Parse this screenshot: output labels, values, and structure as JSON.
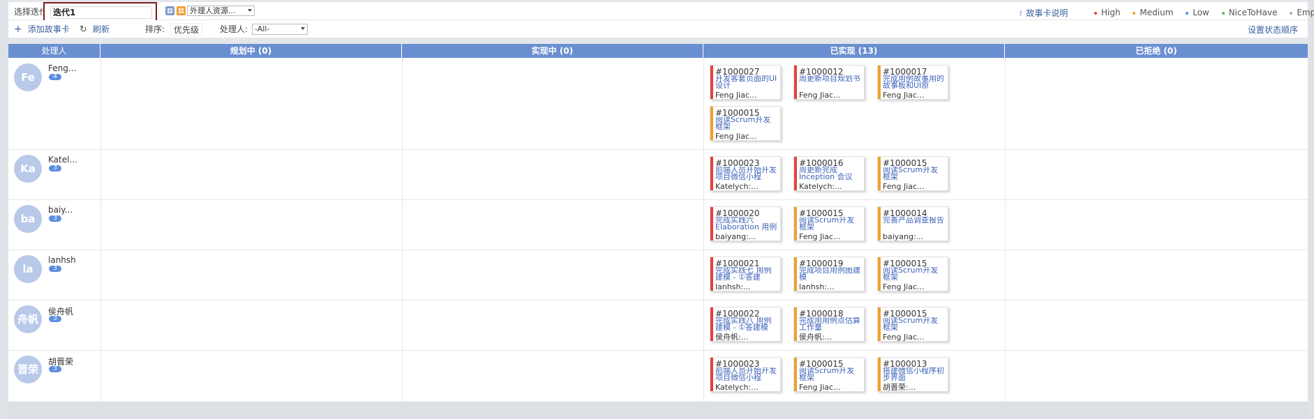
{
  "toolbar": {
    "iteration_label": "选择迭代:",
    "iteration_value": "迭代1",
    "resource_select": "外理人资源...",
    "story_card_help": "故事卡说明",
    "add_story_card": "添加故事卡",
    "refresh": "刷新",
    "sort_label": "排序:",
    "sort_value": "优先级",
    "assignee_label": "处理人:",
    "assignee_value": "-All-",
    "set_status_order": "设置状态顺序"
  },
  "legend": [
    {
      "label": "High",
      "color": "#e84040"
    },
    {
      "label": "Medium",
      "color": "#f0a030"
    },
    {
      "label": "Low",
      "color": "#4a90e2"
    },
    {
      "label": "NiceToHave",
      "color": "#5cb85c"
    },
    {
      "label": "Empty",
      "color": "#aaaaaa"
    }
  ],
  "columns": {
    "assignee": "处理人",
    "planning": "规划中 (0)",
    "in_progress": "实现中 (0)",
    "done": "已实现 (13)",
    "rejected": "已拒绝 (0)"
  },
  "rows": [
    {
      "avatar": "Fe",
      "name": "Feng...",
      "count": "4",
      "cards": [
        {
          "id": "#1000027",
          "title": "开发客套页面的UI设计",
          "owner": "Feng Jiac...",
          "priority": "High"
        },
        {
          "id": "#1000012",
          "title": "周更新项目规划书",
          "owner": "Feng Jiac...",
          "priority": "High"
        },
        {
          "id": "#1000017",
          "title": "完成用例故事用的故事板和UI原",
          "owner": "Feng Jiac...",
          "priority": "Medium"
        },
        {
          "id": "#1000015",
          "title": "阅读Scrum开发框架",
          "owner": "Feng Jiac...",
          "priority": "Medium"
        }
      ]
    },
    {
      "avatar": "Ka",
      "name": "Katel...",
      "count": "3",
      "cards": [
        {
          "id": "#1000023",
          "title": "前端人员开始开发项目微信小程",
          "owner": "Katelych:...",
          "priority": "High"
        },
        {
          "id": "#1000016",
          "title": "周更新完成Inception 会议",
          "owner": "Katelych:...",
          "priority": "High"
        },
        {
          "id": "#1000015",
          "title": "阅读Scrum开发框架",
          "owner": "Feng Jiac...",
          "priority": "Medium"
        }
      ]
    },
    {
      "avatar": "ba",
      "name": "baiy...",
      "count": "3",
      "cards": [
        {
          "id": "#1000020",
          "title": "完成实践六 Elaboration 用例",
          "owner": "baiyang:...",
          "priority": "High"
        },
        {
          "id": "#1000015",
          "title": "阅读Scrum开发框架",
          "owner": "Feng Jiac...",
          "priority": "Medium"
        },
        {
          "id": "#1000014",
          "title": "完善产品调查报告",
          "owner": "baiyang:...",
          "priority": "Medium"
        }
      ]
    },
    {
      "avatar": "la",
      "name": "lanhsh",
      "count": "3",
      "cards": [
        {
          "id": "#1000021",
          "title": "完成实践七 用例建模 - ①答建",
          "owner": "lanhsh:...",
          "priority": "High"
        },
        {
          "id": "#1000019",
          "title": "完成项目用例图建模",
          "owner": "lanhsh:...",
          "priority": "Medium"
        },
        {
          "id": "#1000015",
          "title": "阅读Scrum开发框架",
          "owner": "Feng Jiac...",
          "priority": "Medium"
        }
      ]
    },
    {
      "avatar": "舟帆",
      "name": "侯舟帆",
      "count": "3",
      "cards": [
        {
          "id": "#1000022",
          "title": "完成实践八 用例建模 - ①答建模",
          "owner": "侯舟帆:...",
          "priority": "High"
        },
        {
          "id": "#1000018",
          "title": "完成用用例点估算工作量",
          "owner": "侯舟帆:...",
          "priority": "Medium"
        },
        {
          "id": "#1000015",
          "title": "阅读Scrum开发框架",
          "owner": "Feng Jiac...",
          "priority": "Medium"
        }
      ]
    },
    {
      "avatar": "晋荣",
      "name": "胡晋荣",
      "count": "3",
      "cards": [
        {
          "id": "#1000023",
          "title": "前端人员开始开发项目微信小程",
          "owner": "Katelych:...",
          "priority": "High"
        },
        {
          "id": "#1000015",
          "title": "阅读Scrum开发框架",
          "owner": "Feng Jiac...",
          "priority": "Medium"
        },
        {
          "id": "#1000013",
          "title": "搭建微信小程序初步界面",
          "owner": "胡晋荣:...",
          "priority": "Medium"
        }
      ]
    }
  ],
  "priority_colors": {
    "High": "#e84040",
    "Medium": "#f0a030",
    "Low": "#4a90e2",
    "NiceToHave": "#5cb85c",
    "Empty": "#aaaaaa"
  }
}
